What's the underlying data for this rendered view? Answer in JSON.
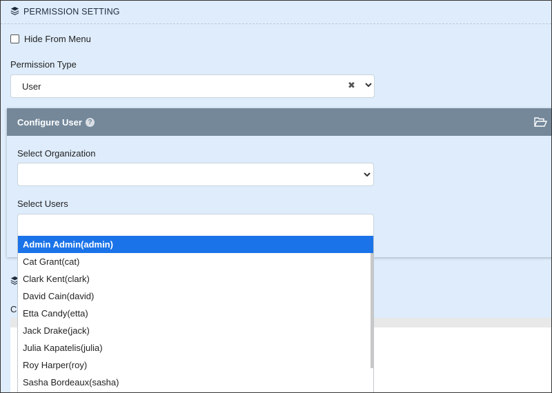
{
  "permission_section": {
    "title": "PERMISSION SETTING",
    "icon": "layers-icon"
  },
  "hide_from_menu": {
    "label": "Hide From Menu",
    "checked": false
  },
  "permission_type": {
    "label": "Permission Type",
    "value": "User",
    "clear_symbol": "✖"
  },
  "configure_user": {
    "title": "Configure User",
    "help_symbol": "?",
    "select_organization_label": "Select Organization",
    "select_organization_value": "",
    "select_users_label": "Select Users",
    "select_users_value": ""
  },
  "background_section": {
    "label_fragment": "Co"
  },
  "users_dropdown": {
    "items": [
      {
        "label": "Admin Admin(admin)",
        "selected": true
      },
      {
        "label": "Cat Grant(cat)",
        "selected": false
      },
      {
        "label": "Clark Kent(clark)",
        "selected": false
      },
      {
        "label": "David Cain(david)",
        "selected": false
      },
      {
        "label": "Etta Candy(etta)",
        "selected": false
      },
      {
        "label": "Jack Drake(jack)",
        "selected": false
      },
      {
        "label": "Julia Kapatelis(julia)",
        "selected": false
      },
      {
        "label": "Roy Harper(roy)",
        "selected": false
      },
      {
        "label": "Sasha Bordeaux(sasha)",
        "selected": false
      }
    ]
  },
  "colors": {
    "page_bg": "#deecfb",
    "panel_header": "#74889a",
    "selected_item": "#1a73e8"
  }
}
